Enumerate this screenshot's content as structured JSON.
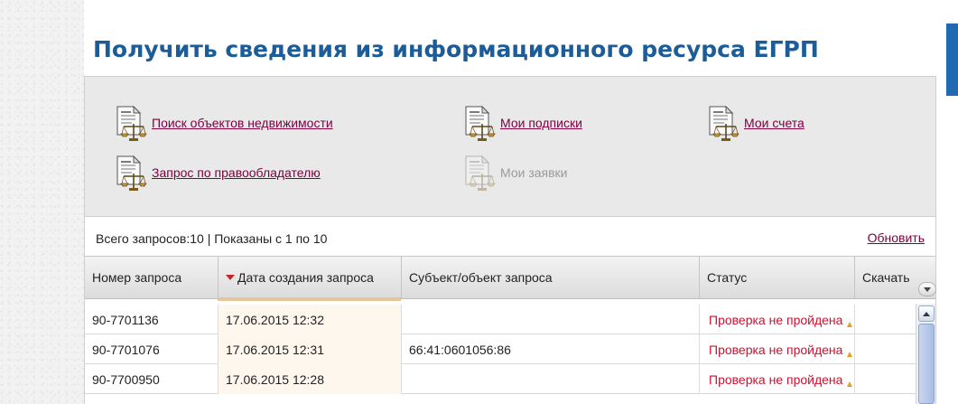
{
  "page": {
    "title": "Получить сведения из информационного ресурса ЕГРП"
  },
  "actions": [
    {
      "label": "Поиск объектов недвижимости",
      "enabled": true,
      "icon": "document-scales-icon"
    },
    {
      "label": "Мои подписки",
      "enabled": true,
      "icon": "document-scales-icon"
    },
    {
      "label": "Мои счета",
      "enabled": true,
      "icon": "document-scales-icon"
    },
    {
      "label": "Запрос по правообладателю",
      "enabled": true,
      "icon": "document-scales-icon"
    },
    {
      "label": "Мои заявки",
      "enabled": false,
      "icon": "document-scales-icon"
    }
  ],
  "grid": {
    "summary": "Всего запросов:10 | Показаны с 1 по 10",
    "refresh_label": "Обновить",
    "columns": [
      {
        "label": "Номер запроса",
        "sorted": false
      },
      {
        "label": "Дата создания запроса",
        "sorted": true,
        "sort_direction": "desc"
      },
      {
        "label": "Субъект/объект запроса",
        "sorted": false
      },
      {
        "label": "Статус",
        "sorted": false
      },
      {
        "label": "Скачать",
        "sorted": false
      }
    ],
    "rows": [
      {
        "number": "90-7701136",
        "date": "17.06.2015 12:32",
        "subject": "",
        "status": "Проверка не пройдена",
        "download": ""
      },
      {
        "number": "90-7701076",
        "date": "17.06.2015 12:31",
        "subject": "66:41:0601056:86",
        "status": "Проверка не пройдена",
        "download": ""
      },
      {
        "number": "90-7700950",
        "date": "17.06.2015 12:28",
        "subject": "",
        "status": "Проверка не пройдена",
        "download": ""
      }
    ]
  },
  "colors": {
    "title": "#1c5c98",
    "link": "#800040",
    "status_error": "#d0102f",
    "accent": "#1f6ab3"
  }
}
